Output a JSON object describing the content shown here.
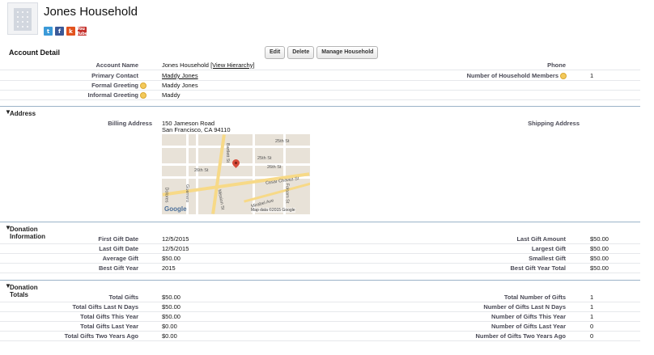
{
  "page": {
    "title": "Jones Household"
  },
  "social": [
    "t",
    "f",
    "k",
    "You Tube"
  ],
  "account_detail": {
    "heading": "Account Detail",
    "buttons": {
      "edit": "Edit",
      "delete": "Delete",
      "manage": "Manage Household"
    },
    "fields": {
      "account_name_label": "Account Name",
      "account_name_value": "Jones Household",
      "view_hierarchy": "[View Hierarchy]",
      "primary_contact_label": "Primary Contact",
      "primary_contact_value": "Maddy Jones",
      "formal_greeting_label": "Formal Greeting",
      "formal_greeting_value": "Maddy Jones",
      "informal_greeting_label": "Informal Greeting",
      "informal_greeting_value": "Maddy",
      "phone_label": "Phone",
      "members_label": "Number of Household Members",
      "members_value": "1"
    }
  },
  "address": {
    "heading": "Address",
    "billing_label": "Billing Address",
    "billing_line1": "150 Jameson Road",
    "billing_line2": "San Francisco, CA 94110",
    "shipping_label": "Shipping Address",
    "map": {
      "streets": [
        "25th St",
        "25th St",
        "26th St",
        "26th St",
        "Bartlett St",
        "Cesar Chavez St",
        "Dolores",
        "Guerrero",
        "Mission St",
        "Mirabel Ave",
        "Folsom St"
      ],
      "logo": "Google",
      "credit": "Map data ©2015 Google"
    }
  },
  "donation_info": {
    "heading": "Donation Information",
    "left": [
      {
        "label": "First Gift Date",
        "value": "12/5/2015"
      },
      {
        "label": "Last Gift Date",
        "value": "12/5/2015"
      },
      {
        "label": "Average Gift",
        "value": "$50.00"
      },
      {
        "label": "Best Gift Year",
        "value": "2015"
      }
    ],
    "right": [
      {
        "label": "Last Gift Amount",
        "value": "$50.00"
      },
      {
        "label": "Largest Gift",
        "value": "$50.00"
      },
      {
        "label": "Smallest Gift",
        "value": "$50.00"
      },
      {
        "label": "Best Gift Year Total",
        "value": "$50.00"
      }
    ]
  },
  "donation_totals": {
    "heading": "Donation Totals",
    "left": [
      {
        "label": "Total Gifts",
        "value": "$50.00"
      },
      {
        "label": "Total Gifts Last N Days",
        "value": "$50.00"
      },
      {
        "label": "Total Gifts This Year",
        "value": "$50.00"
      },
      {
        "label": "Total Gifts Last Year",
        "value": "$0.00"
      },
      {
        "label": "Total Gifts Two Years Ago",
        "value": "$0.00"
      }
    ],
    "right": [
      {
        "label": "Total Number of Gifts",
        "value": "1"
      },
      {
        "label": "Number of Gifts Last N Days",
        "value": "1"
      },
      {
        "label": "Number of Gifts This Year",
        "value": "1"
      },
      {
        "label": "Number of Gifts Last Year",
        "value": "0"
      },
      {
        "label": "Number of Gifts Two Years Ago",
        "value": "0"
      }
    ]
  }
}
